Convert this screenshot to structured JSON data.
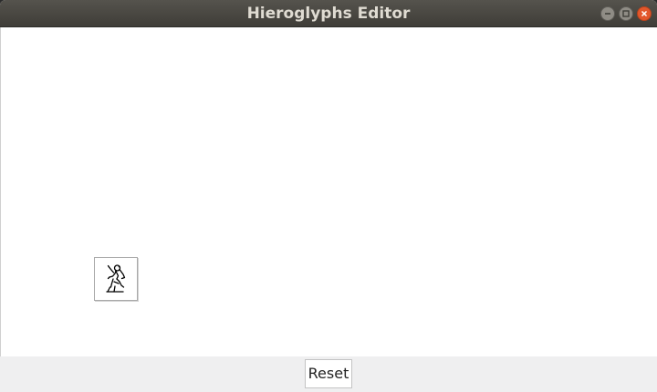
{
  "window": {
    "title": "Hieroglyphs Editor"
  },
  "titlebar_buttons": {
    "minimize_icon": "minimize-icon",
    "maximize_icon": "maximize-icon",
    "close_icon": "close-icon"
  },
  "canvas": {
    "glyphs": [
      {
        "icon": "seated-man-hieroglyph-icon"
      }
    ]
  },
  "bottombar": {
    "reset_label": "Reset"
  },
  "colors": {
    "titlebar": "#46443f",
    "close_button": "#e2572c",
    "canvas_background": "#ffffff",
    "bottombar_background": "#efeff0"
  }
}
